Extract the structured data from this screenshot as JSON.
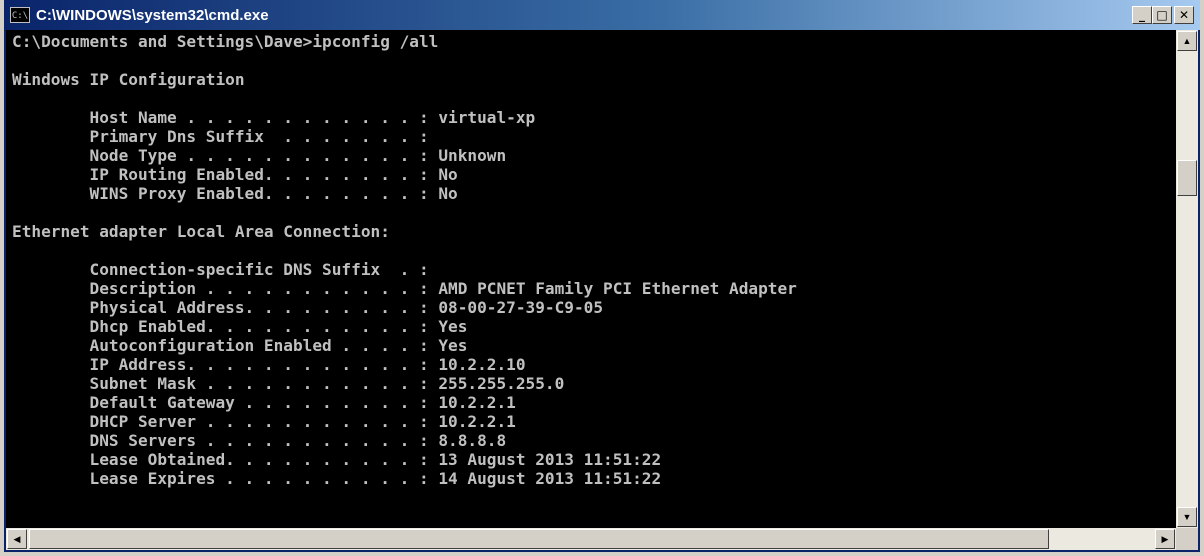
{
  "window": {
    "title": "C:\\WINDOWS\\system32\\cmd.exe",
    "icon_text": "C:\\",
    "colors": {
      "titlebar_start": "#0a246a",
      "titlebar_end": "#a6caf0",
      "console_bg": "#000000",
      "console_fg": "#c0c0c0",
      "chrome": "#d4d0c8"
    }
  },
  "buttons": {
    "minimize_glyph": "_",
    "maximize_glyph": "□",
    "close_glyph": "✕"
  },
  "scroll": {
    "up_glyph": "▲",
    "down_glyph": "▼",
    "left_glyph": "◀",
    "right_glyph": "▶"
  },
  "console": {
    "lines": [
      "C:\\Documents and Settings\\Dave>ipconfig /all",
      "",
      "Windows IP Configuration",
      "",
      "        Host Name . . . . . . . . . . . . : virtual-xp",
      "        Primary Dns Suffix  . . . . . . . :",
      "        Node Type . . . . . . . . . . . . : Unknown",
      "        IP Routing Enabled. . . . . . . . : No",
      "        WINS Proxy Enabled. . . . . . . . : No",
      "",
      "Ethernet adapter Local Area Connection:",
      "",
      "        Connection-specific DNS Suffix  . :",
      "        Description . . . . . . . . . . . : AMD PCNET Family PCI Ethernet Adapter",
      "        Physical Address. . . . . . . . . : 08-00-27-39-C9-05",
      "        Dhcp Enabled. . . . . . . . . . . : Yes",
      "        Autoconfiguration Enabled . . . . : Yes",
      "        IP Address. . . . . . . . . . . . : 10.2.2.10",
      "        Subnet Mask . . . . . . . . . . . : 255.255.255.0",
      "        Default Gateway . . . . . . . . . : 10.2.2.1",
      "        DHCP Server . . . . . . . . . . . : 10.2.2.1",
      "        DNS Servers . . . . . . . . . . . : 8.8.8.8",
      "        Lease Obtained. . . . . . . . . . : 13 August 2013 11:51:22",
      "        Lease Expires . . . . . . . . . . : 14 August 2013 11:51:22",
      ""
    ]
  }
}
